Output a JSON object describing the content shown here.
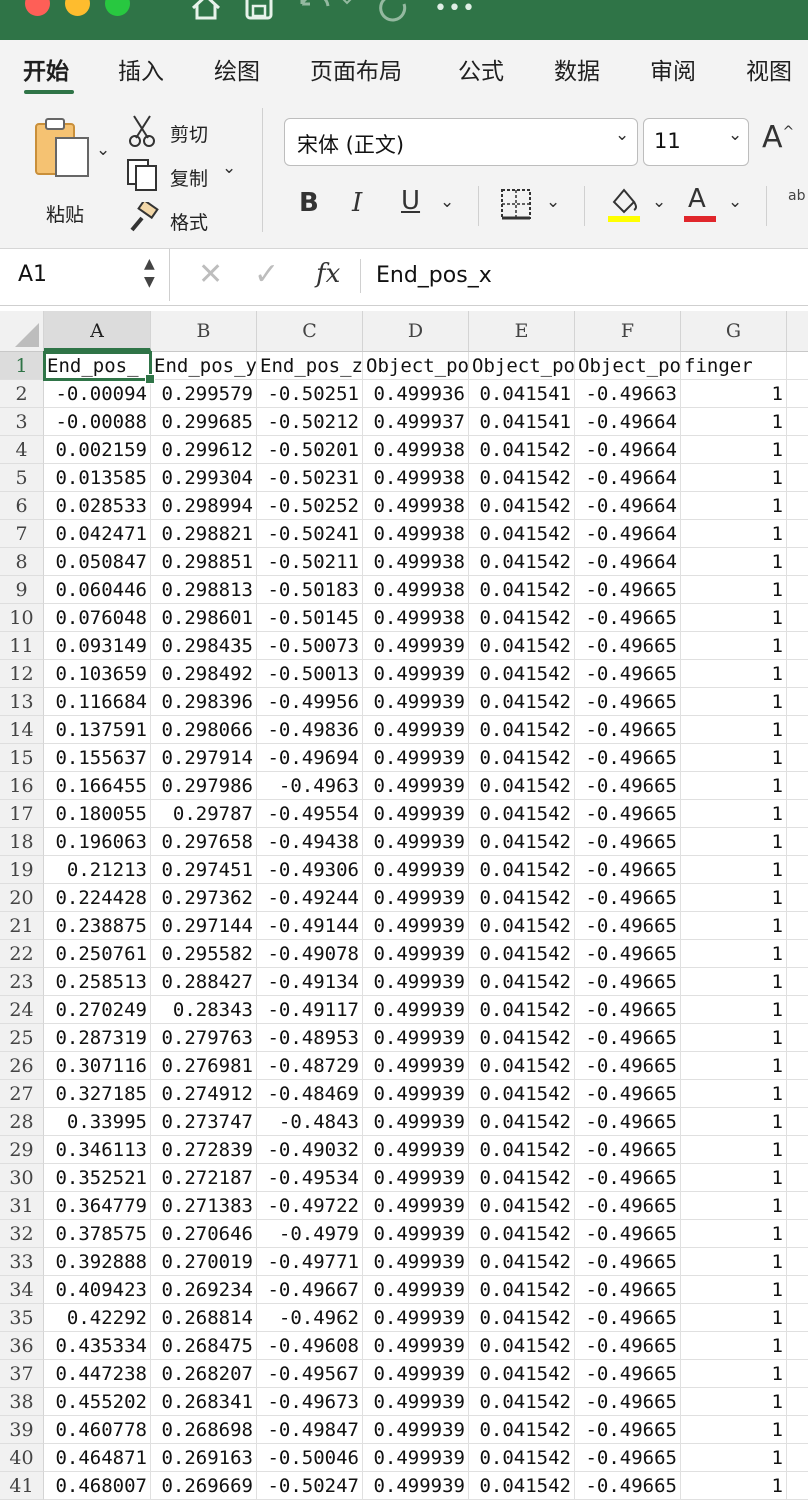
{
  "toolbar": {
    "traffic_lights": [
      {
        "name": "close",
        "color": "#fe5f57"
      },
      {
        "name": "minimize",
        "color": "#febc2e"
      },
      {
        "name": "zoom",
        "color": "#28c840"
      }
    ],
    "quick_access_icons": [
      "home-icon",
      "save-icon",
      "undo-icon",
      "redo-icon",
      "more-icon"
    ],
    "tabs": [
      "开始",
      "插入",
      "绘图",
      "页面布局",
      "公式",
      "数据",
      "审阅",
      "视图"
    ],
    "active_tab": "开始"
  },
  "ribbon": {
    "paste_label": "粘贴",
    "cut_label": "剪切",
    "copy_label": "复制",
    "format_label": "格式",
    "font_name": "宋体 (正文)",
    "font_size": "11",
    "font_grow_glyph": "A",
    "bold": "B",
    "italic": "I",
    "underline": "U",
    "highlight_color": "#ffff00",
    "font_color": "#e0262b",
    "font_color_glyph": "A",
    "wrap_partial": "ab"
  },
  "formula_bar": {
    "name_box": "A1",
    "fx_label": "fx",
    "content": "End_pos_x"
  },
  "grid": {
    "columns": [
      "A",
      "B",
      "C",
      "D",
      "E",
      "F",
      "G"
    ],
    "selected_column": "A",
    "selected_row": 1,
    "header_row": [
      "End_pos_",
      "End_pos_y",
      "End_pos_z",
      "Object_po",
      "Object_po",
      "Object_po",
      "finger"
    ],
    "rows": [
      [
        "-0.00094",
        "0.299579",
        "-0.50251",
        "0.499936",
        "0.041541",
        "-0.49663",
        "1"
      ],
      [
        "-0.00088",
        "0.299685",
        "-0.50212",
        "0.499937",
        "0.041541",
        "-0.49664",
        "1"
      ],
      [
        "0.002159",
        "0.299612",
        "-0.50201",
        "0.499938",
        "0.041542",
        "-0.49664",
        "1"
      ],
      [
        "0.013585",
        "0.299304",
        "-0.50231",
        "0.499938",
        "0.041542",
        "-0.49664",
        "1"
      ],
      [
        "0.028533",
        "0.298994",
        "-0.50252",
        "0.499938",
        "0.041542",
        "-0.49664",
        "1"
      ],
      [
        "0.042471",
        "0.298821",
        "-0.50241",
        "0.499938",
        "0.041542",
        "-0.49664",
        "1"
      ],
      [
        "0.050847",
        "0.298851",
        "-0.50211",
        "0.499938",
        "0.041542",
        "-0.49664",
        "1"
      ],
      [
        "0.060446",
        "0.298813",
        "-0.50183",
        "0.499938",
        "0.041542",
        "-0.49665",
        "1"
      ],
      [
        "0.076048",
        "0.298601",
        "-0.50145",
        "0.499938",
        "0.041542",
        "-0.49665",
        "1"
      ],
      [
        "0.093149",
        "0.298435",
        "-0.50073",
        "0.499939",
        "0.041542",
        "-0.49665",
        "1"
      ],
      [
        "0.103659",
        "0.298492",
        "-0.50013",
        "0.499939",
        "0.041542",
        "-0.49665",
        "1"
      ],
      [
        "0.116684",
        "0.298396",
        "-0.49956",
        "0.499939",
        "0.041542",
        "-0.49665",
        "1"
      ],
      [
        "0.137591",
        "0.298066",
        "-0.49836",
        "0.499939",
        "0.041542",
        "-0.49665",
        "1"
      ],
      [
        "0.155637",
        "0.297914",
        "-0.49694",
        "0.499939",
        "0.041542",
        "-0.49665",
        "1"
      ],
      [
        "0.166455",
        "0.297986",
        "-0.4963",
        "0.499939",
        "0.041542",
        "-0.49665",
        "1"
      ],
      [
        "0.180055",
        "0.29787",
        "-0.49554",
        "0.499939",
        "0.041542",
        "-0.49665",
        "1"
      ],
      [
        "0.196063",
        "0.297658",
        "-0.49438",
        "0.499939",
        "0.041542",
        "-0.49665",
        "1"
      ],
      [
        "0.21213",
        "0.297451",
        "-0.49306",
        "0.499939",
        "0.041542",
        "-0.49665",
        "1"
      ],
      [
        "0.224428",
        "0.297362",
        "-0.49244",
        "0.499939",
        "0.041542",
        "-0.49665",
        "1"
      ],
      [
        "0.238875",
        "0.297144",
        "-0.49144",
        "0.499939",
        "0.041542",
        "-0.49665",
        "1"
      ],
      [
        "0.250761",
        "0.295582",
        "-0.49078",
        "0.499939",
        "0.041542",
        "-0.49665",
        "1"
      ],
      [
        "0.258513",
        "0.288427",
        "-0.49134",
        "0.499939",
        "0.041542",
        "-0.49665",
        "1"
      ],
      [
        "0.270249",
        "0.28343",
        "-0.49117",
        "0.499939",
        "0.041542",
        "-0.49665",
        "1"
      ],
      [
        "0.287319",
        "0.279763",
        "-0.48953",
        "0.499939",
        "0.041542",
        "-0.49665",
        "1"
      ],
      [
        "0.307116",
        "0.276981",
        "-0.48729",
        "0.499939",
        "0.041542",
        "-0.49665",
        "1"
      ],
      [
        "0.327185",
        "0.274912",
        "-0.48469",
        "0.499939",
        "0.041542",
        "-0.49665",
        "1"
      ],
      [
        "0.33995",
        "0.273747",
        "-0.4843",
        "0.499939",
        "0.041542",
        "-0.49665",
        "1"
      ],
      [
        "0.346113",
        "0.272839",
        "-0.49032",
        "0.499939",
        "0.041542",
        "-0.49665",
        "1"
      ],
      [
        "0.352521",
        "0.272187",
        "-0.49534",
        "0.499939",
        "0.041542",
        "-0.49665",
        "1"
      ],
      [
        "0.364779",
        "0.271383",
        "-0.49722",
        "0.499939",
        "0.041542",
        "-0.49665",
        "1"
      ],
      [
        "0.378575",
        "0.270646",
        "-0.4979",
        "0.499939",
        "0.041542",
        "-0.49665",
        "1"
      ],
      [
        "0.392888",
        "0.270019",
        "-0.49771",
        "0.499939",
        "0.041542",
        "-0.49665",
        "1"
      ],
      [
        "0.409423",
        "0.269234",
        "-0.49667",
        "0.499939",
        "0.041542",
        "-0.49665",
        "1"
      ],
      [
        "0.42292",
        "0.268814",
        "-0.4962",
        "0.499939",
        "0.041542",
        "-0.49665",
        "1"
      ],
      [
        "0.435334",
        "0.268475",
        "-0.49608",
        "0.499939",
        "0.041542",
        "-0.49665",
        "1"
      ],
      [
        "0.447238",
        "0.268207",
        "-0.49567",
        "0.499939",
        "0.041542",
        "-0.49665",
        "1"
      ],
      [
        "0.455202",
        "0.268341",
        "-0.49673",
        "0.499939",
        "0.041542",
        "-0.49665",
        "1"
      ],
      [
        "0.460778",
        "0.268698",
        "-0.49847",
        "0.499939",
        "0.041542",
        "-0.49665",
        "1"
      ],
      [
        "0.464871",
        "0.269163",
        "-0.50046",
        "0.499939",
        "0.041542",
        "-0.49665",
        "1"
      ],
      [
        "0.468007",
        "0.269669",
        "-0.50247",
        "0.499939",
        "0.041542",
        "-0.49665",
        "1"
      ]
    ]
  }
}
